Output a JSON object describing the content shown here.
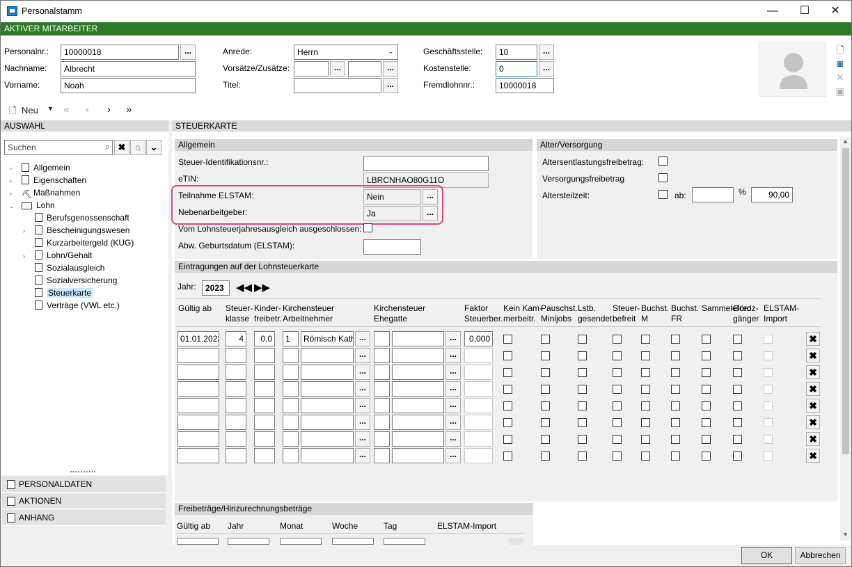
{
  "window": {
    "title": "Personalstamm",
    "minimize": "—",
    "maximize": "☐",
    "close": "✕"
  },
  "banner": "AKTIVER MITARBEITER",
  "header": {
    "personalnr_label": "Personalnr.:",
    "personalnr": "10000018",
    "nachname_label": "Nachname:",
    "nachname": "Albrecht",
    "vorname_label": "Vorname:",
    "vorname": "Noah",
    "anrede_label": "Anrede:",
    "anrede": "Herrn",
    "vorsaetze_label": "Vorsätze/Zusätze:",
    "titel_label": "Titel:",
    "geschaeftsstelle_label": "Geschäftsstelle:",
    "geschaeftsstelle": "10",
    "kostenstelle_label": "Kostenstelle:",
    "kostenstelle": "0",
    "fremdlohnnr_label": "Fremdlohnnr.:",
    "fremdlohnnr": "10000018",
    "dots": "..."
  },
  "nav": {
    "neu": "Neu",
    "first": "«",
    "prev": "‹",
    "next": "›",
    "last": "»"
  },
  "left": {
    "section": "AUSWAHL",
    "search_placeholder": "Suchen",
    "tree": [
      "Allgemein",
      "Eigenschaften",
      "Maßnahmen",
      "Lohn",
      "Berufsgenossenschaft",
      "Bescheinigungswesen",
      "Kurzarbeitergeld (KUG)",
      "Lohn/Gehalt",
      "Sozialausgleich",
      "Sozialversicherung",
      "Steuerkarte",
      "Verträge (VWL etc.)"
    ],
    "accordion": [
      "PERSONALDATEN",
      "AKTIONEN",
      "ANHANG"
    ]
  },
  "main": {
    "section": "STEUERKARTE",
    "allgemein": {
      "title": "Allgemein",
      "steuer_id_label": "Steuer-Identifikationsnr.:",
      "steuer_id": "",
      "etin_label": "eTIN:",
      "etin": "LBRCNHAO80G11O",
      "elstam_label": "Teilnahme ELSTAM:",
      "elstam": "Nein",
      "neben_label": "Nebenarbeitgeber:",
      "neben": "Ja",
      "vom_label": "Vom Lohnsteuerjahresausgleich ausgeschlossen:",
      "geb_label": "Abw. Geburtsdatum (ELSTAM):"
    },
    "alter": {
      "title": "Alter/Versorgung",
      "ae_label": "Altersentlastungsfreibetrag:",
      "vf_label": "Versorgungsfreibetrag",
      "az_label": "Altersteilzeit:",
      "ab_label": "ab:",
      "pct": "%",
      "pct_value": "90,00"
    },
    "eintragungen": {
      "title": "Eintragungen auf der Lohnsteuerkarte",
      "jahr_label": "Jahr:",
      "jahr": "2023",
      "headers": [
        "Gültig ab",
        "Steuer-\nklasse",
        "Kinder-\nfreibetr.",
        "Kirchensteuer\nArbeitnehmer",
        "Kirchensteuer\nEhegatte",
        "Faktor\nSteuerber.",
        "Kein Kam-\nmerbeitr.",
        "Pauschst.\nMinijobs",
        "Lstb.\ngesendet",
        "Steuer-\nbefreit",
        "Buchst.\nM",
        "Buchst.\nFR",
        "Sammel\beförd.",
        "Grenz-\ngänger",
        "ELSTAM-\nImport"
      ],
      "row1": {
        "gueltig": "01.01.2023",
        "klasse": "4",
        "kinder": "0,0",
        "kist_code": "1",
        "kist_an": "Römisch Kath",
        "faktor": "0,000"
      },
      "delete_icon": "✖"
    },
    "freibetraege": {
      "title": "Freibeträge/Hinzurechnungsbeträge",
      "headers": [
        "Gültig ab",
        "Jahr",
        "Monat",
        "Woche",
        "Tag",
        "ELSTAM-Import"
      ]
    }
  },
  "footer": {
    "ok": "OK",
    "abbrechen": "Abbrechen"
  }
}
